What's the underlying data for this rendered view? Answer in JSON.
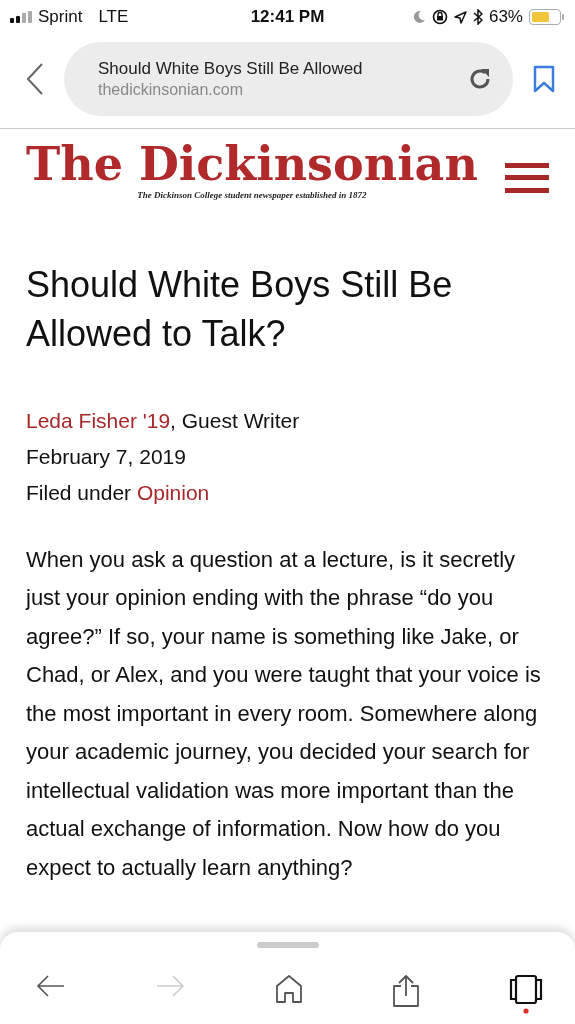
{
  "status_bar": {
    "carrier": "Sprint",
    "network": "LTE",
    "time": "12:41 PM",
    "battery": "63%"
  },
  "address_bar": {
    "title": "Should White Boys Still Be Allowed",
    "domain": "thedickinsonian.com"
  },
  "masthead": {
    "name": "The Dickinsonian",
    "tagline": "The Dickinson College student newspaper established in 1872"
  },
  "article": {
    "title": "Should White Boys Still Be Allowed to Talk?",
    "author": "Leda Fisher '19",
    "author_role": ", Guest Writer",
    "date": "February 7, 2019",
    "filed_label": "Filed under",
    "category": "Opinion",
    "body": "When you ask a question at a lecture, is it secretly just your opinion ending with the phrase “do you agree?” If so, your name is something like Jake, or Chad, or Alex, and you were taught that your voice is the most important in every room. Somewhere along your academic journey, you decided your search for intellectual validation was more important than the actual exchange of information. Now how do you expect to actually learn anything?"
  },
  "toolbar": [
    {
      "kind": "back",
      "disabled": false
    },
    {
      "kind": "forward",
      "disabled": true
    },
    {
      "kind": "home",
      "disabled": false
    },
    {
      "kind": "share",
      "disabled": false
    },
    {
      "kind": "tabs",
      "disabled": false
    }
  ]
}
